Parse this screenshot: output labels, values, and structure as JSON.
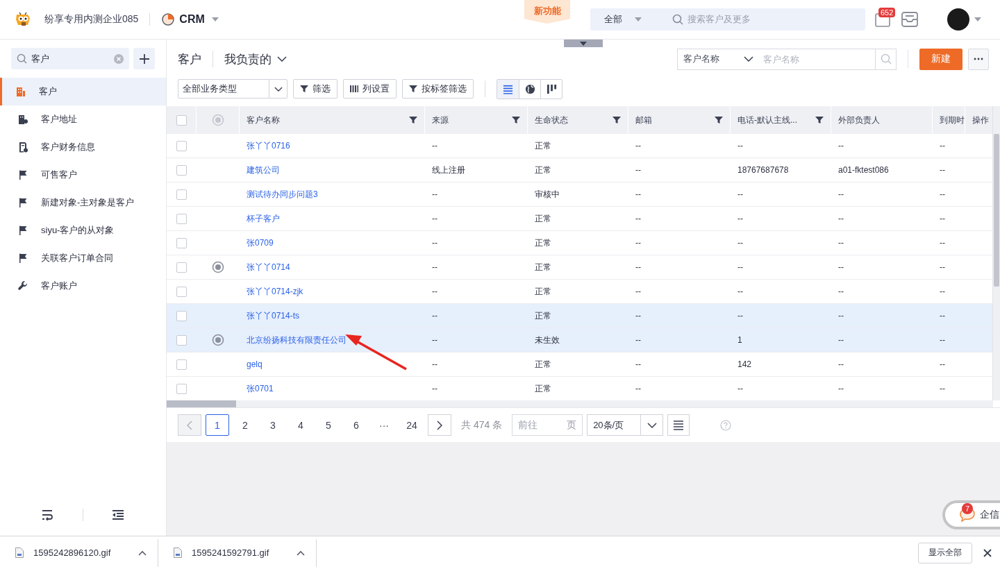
{
  "topbar": {
    "company": "纷享专用内测企业085",
    "app": "CRM",
    "new_feature": "新功能",
    "search_scope": "全部",
    "search_placeholder": "搜索客户及更多",
    "mail_badge": "652"
  },
  "sidebar": {
    "search_value": "客户",
    "items": [
      {
        "label": "客户",
        "kind": "building",
        "selected": true
      },
      {
        "label": "客户地址",
        "kind": "address",
        "selected": false
      },
      {
        "label": "客户财务信息",
        "kind": "document",
        "selected": false
      },
      {
        "label": "可售客户",
        "kind": "flag",
        "selected": false
      },
      {
        "label": "新建对象-主对象是客户",
        "kind": "flag",
        "selected": false
      },
      {
        "label": "siyu-客户的从对象",
        "kind": "flag",
        "selected": false
      },
      {
        "label": "关联客户订单合同",
        "kind": "flag",
        "selected": false
      },
      {
        "label": "客户账户",
        "kind": "wrench",
        "selected": false
      }
    ]
  },
  "header": {
    "title": "客户",
    "scope": "我负责的",
    "search_field": "客户名称",
    "search_placeholder": "客户名称",
    "new_button": "新建"
  },
  "toolbar": {
    "type_select": "全部业务类型",
    "buttons": [
      {
        "label": "筛选",
        "kind": "filter"
      },
      {
        "label": "列设置",
        "kind": "columns"
      },
      {
        "label": "按标签筛选",
        "kind": "filter"
      }
    ],
    "views": [
      {
        "kind": "list",
        "selected": true
      },
      {
        "kind": "map",
        "selected": false
      },
      {
        "kind": "kanban",
        "selected": false
      }
    ]
  },
  "table": {
    "all_checked": false,
    "columns": [
      "客户名称",
      "来源",
      "生命状态",
      "邮箱",
      "电话-默认主线...",
      "外部负责人",
      "到期时",
      "操作"
    ],
    "rows": [
      {
        "checked": false,
        "located": false,
        "highlighted": false,
        "cells": [
          "张丫丫0716",
          "--",
          "正常",
          "--",
          "--",
          "--",
          "--",
          ""
        ]
      },
      {
        "checked": false,
        "located": false,
        "highlighted": false,
        "cells": [
          "建筑公司",
          "线上注册",
          "正常",
          "--",
          "18767687678",
          "a01-fktest086",
          "--",
          ""
        ]
      },
      {
        "checked": false,
        "located": false,
        "highlighted": false,
        "cells": [
          "测试待办同步问题3",
          "--",
          "审核中",
          "--",
          "--",
          "--",
          "--",
          ""
        ]
      },
      {
        "checked": false,
        "located": false,
        "highlighted": false,
        "cells": [
          "杯子客户",
          "--",
          "正常",
          "--",
          "--",
          "--",
          "--",
          ""
        ]
      },
      {
        "checked": false,
        "located": false,
        "highlighted": false,
        "cells": [
          "张0709",
          "--",
          "正常",
          "--",
          "--",
          "--",
          "--",
          ""
        ]
      },
      {
        "checked": false,
        "located": true,
        "highlighted": false,
        "cells": [
          "张丫丫0714",
          "--",
          "正常",
          "--",
          "--",
          "--",
          "--",
          ""
        ]
      },
      {
        "checked": false,
        "located": false,
        "highlighted": false,
        "cells": [
          "张丫丫0714-zjk",
          "--",
          "正常",
          "--",
          "--",
          "--",
          "--",
          ""
        ]
      },
      {
        "checked": false,
        "located": false,
        "highlighted": true,
        "cells": [
          "张丫丫0714-ts",
          "--",
          "正常",
          "--",
          "--",
          "--",
          "--",
          ""
        ]
      },
      {
        "checked": false,
        "located": true,
        "highlighted": true,
        "cells": [
          "北京纷扬科技有限责任公司",
          "--",
          "未生效",
          "--",
          "1",
          "--",
          "--",
          ""
        ]
      },
      {
        "checked": false,
        "located": false,
        "highlighted": false,
        "cells": [
          "gelq",
          "--",
          "正常",
          "--",
          "142",
          "--",
          "--",
          ""
        ]
      },
      {
        "checked": false,
        "located": false,
        "highlighted": false,
        "cells": [
          "张0701",
          "--",
          "正常",
          "--",
          "--",
          "--",
          "--",
          ""
        ]
      }
    ]
  },
  "pagination": {
    "pages": [
      {
        "label": "1",
        "selected": true
      },
      {
        "label": "2",
        "selected": false
      },
      {
        "label": "3",
        "selected": false
      },
      {
        "label": "4",
        "selected": false
      },
      {
        "label": "5",
        "selected": false
      },
      {
        "label": "6",
        "selected": false
      },
      {
        "label": "···",
        "selected": false
      },
      {
        "label": "24",
        "selected": false
      }
    ],
    "total": "共 474 条",
    "goto_placeholder": "前往",
    "goto_unit": "页",
    "page_size": "20条/页"
  },
  "chat": {
    "label": "企信",
    "badge": "7"
  },
  "downloads": {
    "files": [
      "1595242896120.gif",
      "1595241592791.gif"
    ],
    "show_all": "显示全部"
  }
}
